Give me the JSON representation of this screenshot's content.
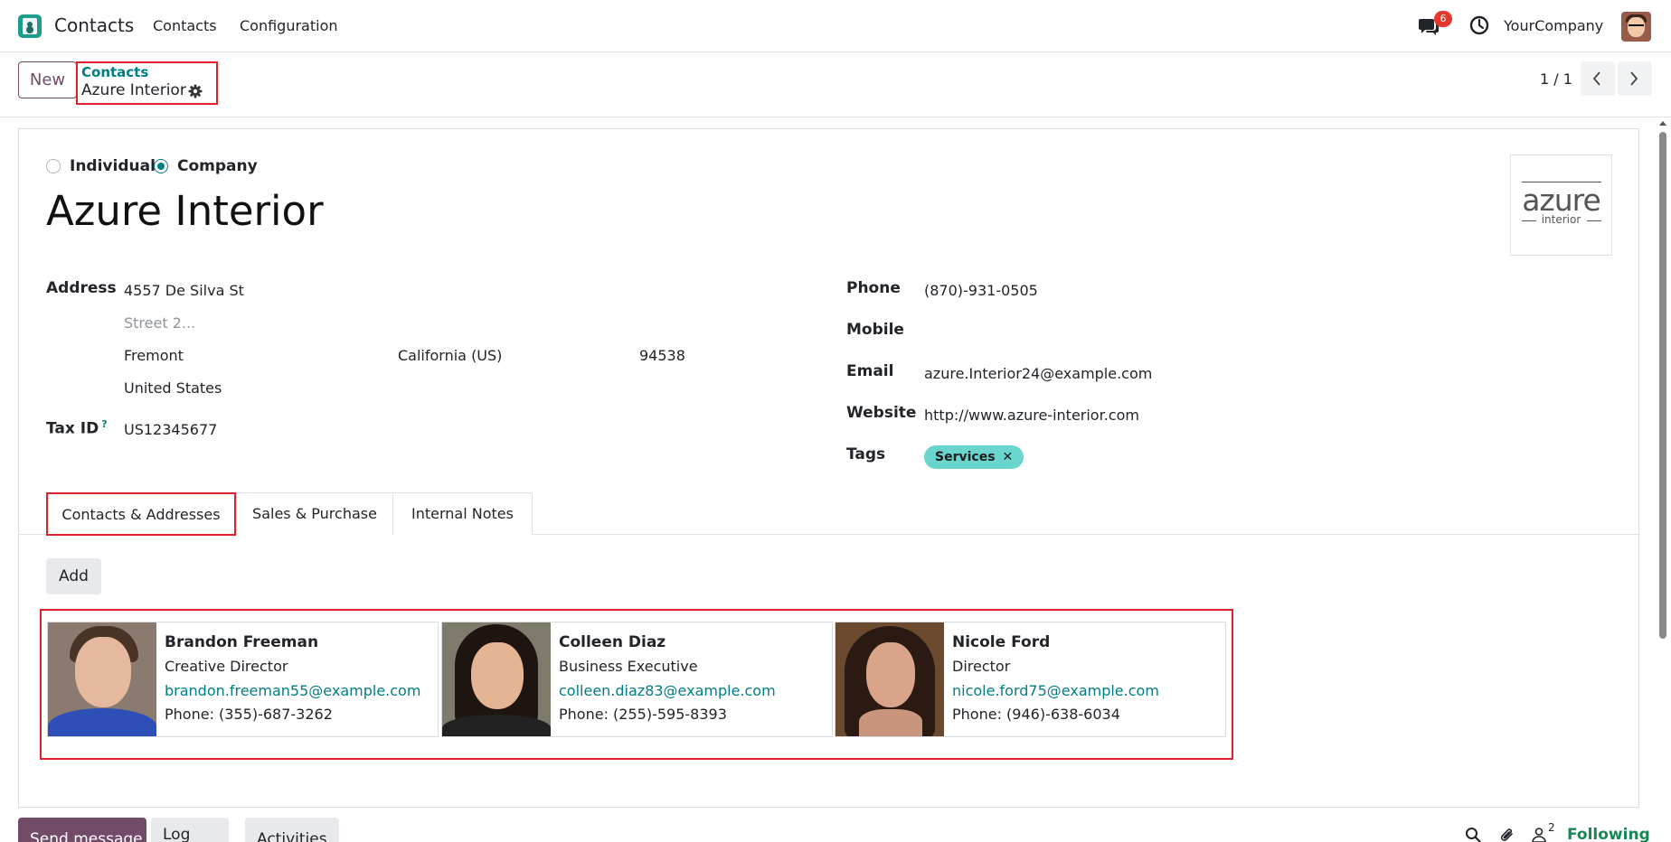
{
  "navbar": {
    "app_name": "Contacts",
    "menu": [
      "Contacts",
      "Configuration"
    ],
    "messages_badge": "6",
    "company": "YourCompany"
  },
  "control": {
    "new_label": "New",
    "breadcrumb_parent": "Contacts",
    "breadcrumb_current": "Azure Interior",
    "pager": "1 / 1"
  },
  "form": {
    "type_options": [
      "Individual",
      "Company"
    ],
    "type_selected": "Company",
    "name": "Azure Interior",
    "logo": {
      "main": "azure",
      "sub": "interior"
    },
    "address_label": "Address",
    "street": "4557 De Silva St",
    "street2_placeholder": "Street 2...",
    "city": "Fremont",
    "state": "California (US)",
    "zip": "94538",
    "country": "United States",
    "tax_label": "Tax ID",
    "tax_help": "?",
    "tax_id": "US12345677",
    "phone_label": "Phone",
    "phone": "(870)-931-0505",
    "mobile_label": "Mobile",
    "email_label": "Email",
    "email": "azure.Interior24@example.com",
    "website_label": "Website",
    "website": "http://www.azure-interior.com",
    "tags_label": "Tags",
    "tag": "Services",
    "tag_close": "✕"
  },
  "tabs": [
    {
      "label": "Contacts & Addresses",
      "active": true
    },
    {
      "label": "Sales & Purchase",
      "active": false
    },
    {
      "label": "Internal Notes",
      "active": false
    }
  ],
  "add_label": "Add",
  "contacts": [
    {
      "name": "Brandon Freeman",
      "function": "Creative Director",
      "email": "brandon.freeman55@example.com",
      "phone": "Phone: (355)-687-3262"
    },
    {
      "name": "Colleen Diaz",
      "function": "Business Executive",
      "email": "colleen.diaz83@example.com",
      "phone": "Phone: (255)-595-8393"
    },
    {
      "name": "Nicole Ford",
      "function": "Director",
      "email": "nicole.ford75@example.com",
      "phone": "Phone: (946)-638-6034"
    }
  ],
  "chatter": {
    "send_label": "Send message",
    "log_label": "Log note",
    "activities_label": "Activities",
    "followers": "2",
    "following_label": "Following"
  },
  "colors": {
    "brand": "#714b67",
    "accent": "#017e84",
    "highlight_box": "#e2202c",
    "tag": "#6ad5cd",
    "following": "#198754",
    "badge": "#e4382f"
  }
}
